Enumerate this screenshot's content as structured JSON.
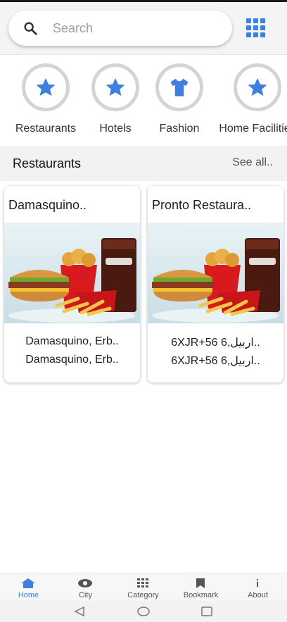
{
  "search": {
    "placeholder": "Search"
  },
  "categories": [
    {
      "label": "Restaurants",
      "icon": "star-icon"
    },
    {
      "label": "Hotels",
      "icon": "star-icon"
    },
    {
      "label": "Fashion",
      "icon": "shirt-icon"
    },
    {
      "label": "Home Facilities",
      "icon": "star-icon"
    }
  ],
  "section": {
    "title": "Restaurants",
    "see_all": "See all.."
  },
  "cards": [
    {
      "name": "Damasquino..",
      "line1": "Damasquino, Erb..",
      "line2": "Damasquino, Erb.."
    },
    {
      "name": "Pronto Restaura..",
      "line1": "6XJR+56 6,اربيل..",
      "line2": "6XJR+56 6,اربيل.."
    }
  ],
  "nav": [
    {
      "label": "Home",
      "icon": "home-icon",
      "active": true
    },
    {
      "label": "City",
      "icon": "eye-icon",
      "active": false
    },
    {
      "label": "Category",
      "icon": "grid-icon",
      "active": false
    },
    {
      "label": "Bookmark",
      "icon": "bookmark-icon",
      "active": false
    },
    {
      "label": "About",
      "icon": "info-icon",
      "active": false
    }
  ],
  "colors": {
    "accent": "#3f7fe0",
    "ring": "#d4d4d4",
    "section_bg": "#f2f2f2"
  }
}
